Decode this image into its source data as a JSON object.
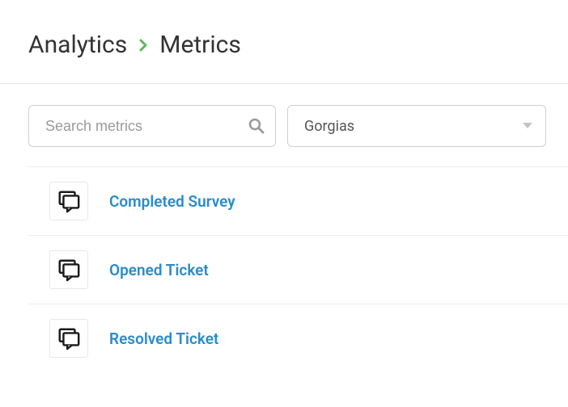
{
  "breadcrumb": {
    "root": "Analytics",
    "current": "Metrics"
  },
  "toolbar": {
    "search_placeholder": "Search metrics",
    "select_value": "Gorgias"
  },
  "metrics": {
    "items": [
      {
        "label": "Completed Survey",
        "icon": "chat-icon"
      },
      {
        "label": "Opened Ticket",
        "icon": "chat-icon"
      },
      {
        "label": "Resolved Ticket",
        "icon": "chat-icon"
      }
    ]
  }
}
